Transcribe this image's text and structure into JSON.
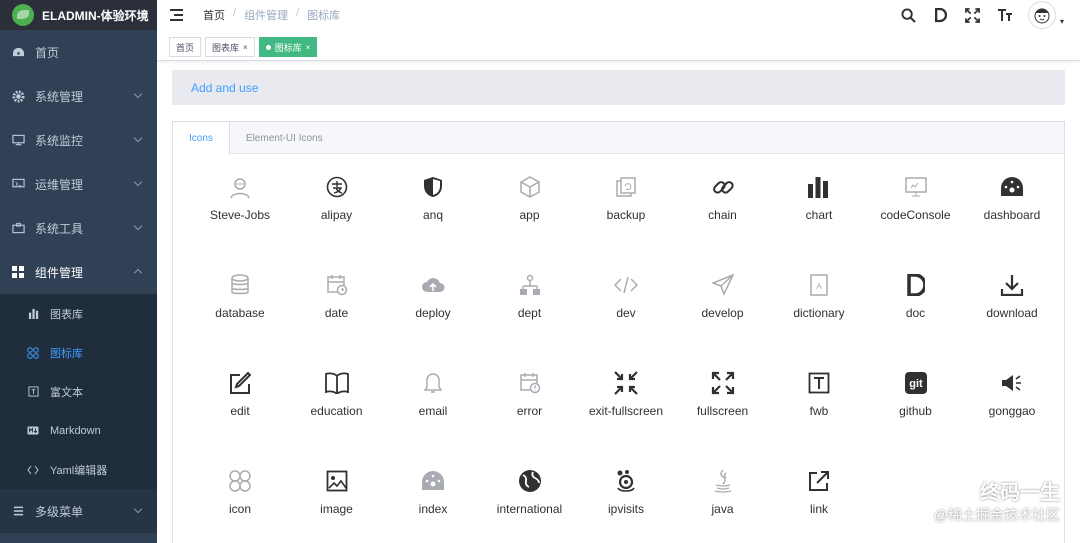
{
  "app_title": "ELADMIN-体验环境",
  "sidebar": {
    "items": [
      {
        "label": "首页",
        "icon": "dashboard-icon"
      },
      {
        "label": "系统管理",
        "icon": "gear-icon"
      },
      {
        "label": "系统监控",
        "icon": "monitor-icon"
      },
      {
        "label": "运维管理",
        "icon": "ops-icon"
      },
      {
        "label": "系统工具",
        "icon": "tools-icon"
      },
      {
        "label": "组件管理",
        "icon": "components-icon"
      }
    ],
    "sub_items": [
      {
        "label": "图表库",
        "icon": "chart-icon"
      },
      {
        "label": "图标库",
        "icon": "icon-lib-icon"
      },
      {
        "label": "富文本",
        "icon": "richtext-icon"
      },
      {
        "label": "Markdown",
        "icon": "markdown-icon"
      },
      {
        "label": "Yaml编辑器",
        "icon": "code-icon"
      }
    ],
    "last_item": {
      "label": "多级菜单",
      "icon": "menu-icon"
    }
  },
  "breadcrumb": [
    "首页",
    "组件管理",
    "图标库"
  ],
  "tags": [
    {
      "label": "首页"
    },
    {
      "label": "图表库"
    },
    {
      "label": "图标库"
    }
  ],
  "addbar": {
    "label": "Add and use"
  },
  "tabs": [
    "Icons",
    "Element-UI Icons"
  ],
  "icons": [
    "Steve-Jobs",
    "alipay",
    "anq",
    "app",
    "backup",
    "chain",
    "chart",
    "codeConsole",
    "dashboard",
    "database",
    "date",
    "deploy",
    "dept",
    "dev",
    "develop",
    "dictionary",
    "doc",
    "download",
    "edit",
    "education",
    "email",
    "error",
    "exit-fullscreen",
    "fullscreen",
    "fwb",
    "github",
    "gonggao",
    "icon",
    "image",
    "index",
    "international",
    "ipvisits",
    "java",
    "link"
  ],
  "watermark": {
    "line1": "终码一生",
    "line2": "@稀土掘金技术社区"
  },
  "colors": {
    "sidebar_bg": "#304156",
    "active_blue": "#409eff",
    "tag_green": "#42b983"
  }
}
